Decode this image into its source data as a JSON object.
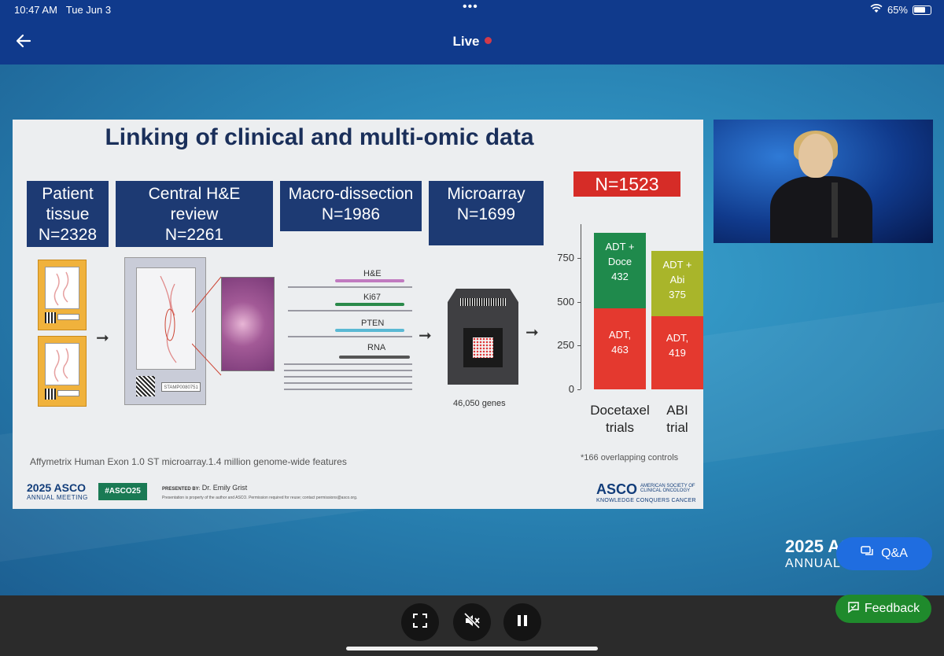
{
  "status_bar": {
    "time": "10:47 AM",
    "date": "Tue Jun 3",
    "battery": "65%"
  },
  "header": {
    "title": "Live"
  },
  "slide": {
    "title": "Linking of clinical and multi-omic data",
    "steps": [
      {
        "title": "Patient tissue",
        "n": "N=2328"
      },
      {
        "title": "Central H&E review",
        "n": "N=2261"
      },
      {
        "title": "Macro-dissection",
        "n": "N=1986"
      },
      {
        "title": "Microarray",
        "n": "N=1699"
      }
    ],
    "lanes": [
      "H&E",
      "Ki67",
      "PTEN",
      "RNA"
    ],
    "slide_stamp": "STAMP0080751",
    "chip_label": "46,050 genes",
    "total": "N=1523",
    "footnote_left": "Affymetrix Human Exon 1.0 ST microarray.1.4 million genome-wide features",
    "footnote_right": "*166 overlapping controls",
    "footer": {
      "logo_year": "2025 ASCO",
      "logo_sub": "ANNUAL MEETING",
      "hashtag": "#ASCO25",
      "presenter_prefix": "PRESENTED BY:",
      "presenter": "Dr. Emily Grist",
      "disclaimer": "Presentation is property of the author and ASCO. Permission required for reuse; contact permissions@asco.org.",
      "asco": "ASCO",
      "asco_full": "AMERICAN SOCIETY OF CLINICAL ONCOLOGY",
      "asco_tagline": "KNOWLEDGE CONQUERS CANCER"
    }
  },
  "chart_data": {
    "type": "bar",
    "stacked": true,
    "categories": [
      "Docetaxel trials",
      "ABI trial"
    ],
    "yticks": [
      0,
      250,
      500,
      750
    ],
    "ylim": [
      0,
      900
    ],
    "series": [
      {
        "name": "ADT",
        "values": [
          463,
          419
        ],
        "labels": [
          "ADT,\n463",
          "ADT,\n419"
        ],
        "color": "#e4392f"
      },
      {
        "name": "ADT + Doce / ADT + Abi",
        "values": [
          432,
          375
        ],
        "labels": [
          "ADT +\nDoce\n432",
          "ADT +\nAbi\n375"
        ],
        "colors": [
          "#1f8a4c",
          "#a9b52a"
        ]
      }
    ]
  },
  "overlay": {
    "brand_year": "2025 ASCO",
    "brand_sub": "ANNUAL",
    "qa": "Q&A",
    "feedback": "Feedback"
  },
  "controls": [
    "fullscreen-icon",
    "mute-icon",
    "pause-icon"
  ]
}
